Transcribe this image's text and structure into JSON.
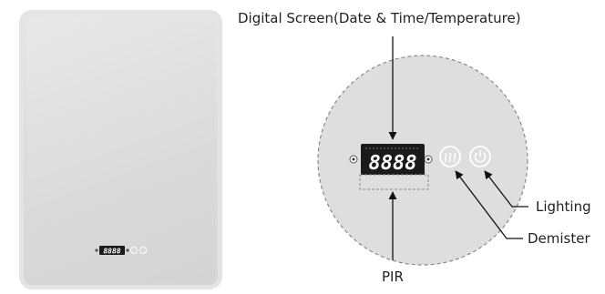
{
  "labels": {
    "digital_screen": "Digital Screen(Date & Time/Temperature)",
    "lighting": "Lighting",
    "demister": "Demister",
    "pir": "PIR"
  },
  "display": {
    "digits": "8888",
    "mini_digits": "8888"
  },
  "icons": {
    "demister": "demister-icon",
    "lighting": "power-icon"
  },
  "colors": {
    "display_bg": "#1a1a1a",
    "display_digits": "#ff3030",
    "circle_fill": "#dcdcdc",
    "circle_border": "#8a8a8a",
    "icon_white": "#ffffff",
    "line": "#111111"
  }
}
